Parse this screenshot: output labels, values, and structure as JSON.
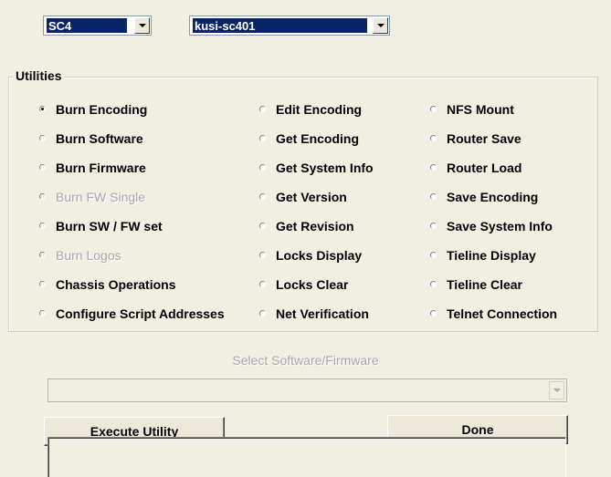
{
  "system_select": {
    "value": "SC4"
  },
  "host_select": {
    "value": "kusi-sc401"
  },
  "utilities": {
    "title": "Utilities",
    "col1": [
      {
        "label": "Burn Encoding",
        "checked": true,
        "enabled": true
      },
      {
        "label": "Burn Software",
        "checked": false,
        "enabled": true
      },
      {
        "label": "Burn Firmware",
        "checked": false,
        "enabled": true
      },
      {
        "label": "Burn FW Single",
        "checked": false,
        "enabled": false
      },
      {
        "label": "Burn SW / FW set",
        "checked": false,
        "enabled": true
      },
      {
        "label": "Burn Logos",
        "checked": false,
        "enabled": false
      },
      {
        "label": "Chassis Operations",
        "checked": false,
        "enabled": true
      },
      {
        "label": "Configure Script Addresses",
        "checked": false,
        "enabled": true
      }
    ],
    "col2": [
      {
        "label": "Edit Encoding",
        "checked": false,
        "enabled": true
      },
      {
        "label": "Get Encoding",
        "checked": false,
        "enabled": true
      },
      {
        "label": "Get System Info",
        "checked": false,
        "enabled": true
      },
      {
        "label": "Get Version",
        "checked": false,
        "enabled": true
      },
      {
        "label": "Get Revision",
        "checked": false,
        "enabled": true
      },
      {
        "label": "Locks Display",
        "checked": false,
        "enabled": true
      },
      {
        "label": "Locks Clear",
        "checked": false,
        "enabled": true
      },
      {
        "label": "Net Verification",
        "checked": false,
        "enabled": true
      }
    ],
    "col3": [
      {
        "label": "NFS Mount",
        "checked": false,
        "enabled": true
      },
      {
        "label": "Router Save",
        "checked": false,
        "enabled": true
      },
      {
        "label": "Router Load",
        "checked": false,
        "enabled": true
      },
      {
        "label": "Save Encoding",
        "checked": false,
        "enabled": true
      },
      {
        "label": "Save System Info",
        "checked": false,
        "enabled": true
      },
      {
        "label": "Tieline Display",
        "checked": false,
        "enabled": true
      },
      {
        "label": "Tieline Clear",
        "checked": false,
        "enabled": true
      },
      {
        "label": "Telnet Connection",
        "checked": false,
        "enabled": true
      }
    ]
  },
  "software_select": {
    "label": "Select Software/Firmware",
    "value": ""
  },
  "buttons": {
    "execute": "Execute Utility",
    "done": "Done"
  },
  "status": {
    "text": ""
  }
}
